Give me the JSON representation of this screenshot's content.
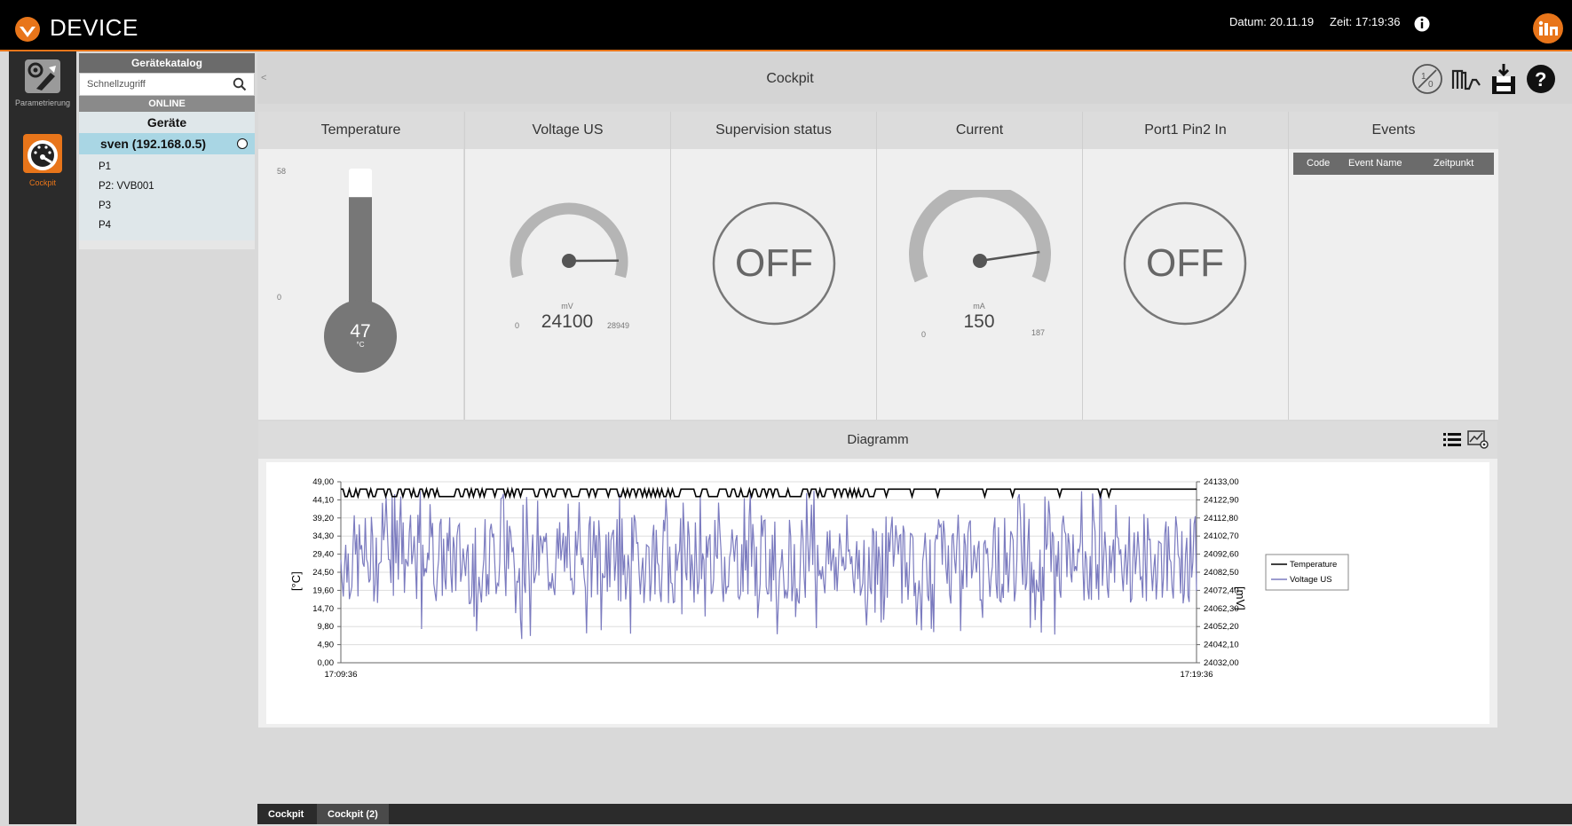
{
  "app": {
    "brand": "DEVICE",
    "date_text": "Datum: 20.11.19",
    "time_text": "Zeit: 17:19:36"
  },
  "nav": {
    "items": [
      {
        "label": "Parametrierung"
      },
      {
        "label": "Cockpit"
      }
    ]
  },
  "catalog": {
    "title": "Gerätekatalog",
    "search_placeholder": "Schnellzugriff",
    "status": "ONLINE",
    "group": "Geräte",
    "device": "sven (192.168.0.5)",
    "ports": [
      "P1",
      "P2: VVB001",
      "P3",
      "P4"
    ]
  },
  "header": {
    "title": "Cockpit"
  },
  "panels": {
    "temperature": {
      "title": "Temperature",
      "max": "58",
      "min": "0",
      "value": "47",
      "unit": "°C",
      "level": 47
    },
    "voltage": {
      "title": "Voltage US",
      "unit": "mV",
      "value": "24100",
      "min": "0",
      "max": "28949",
      "level": 24100,
      "max_num": 28949
    },
    "supervision": {
      "title": "Supervision status",
      "state": "OFF"
    },
    "current": {
      "title": "Current",
      "unit": "mA",
      "value": "150",
      "min": "0",
      "max": "187",
      "level": 150,
      "max_num": 187
    },
    "port1pin2": {
      "title": "Port1 Pin2 In",
      "state": "OFF"
    },
    "events": {
      "title": "Events",
      "columns": [
        "Code",
        "Event Name",
        "Zeitpunkt"
      ]
    }
  },
  "diagram": {
    "title": "Diagramm"
  },
  "chart_data": {
    "type": "line",
    "ylabel": "[°C]",
    "y2label": "[mV]",
    "y_ticks": [
      "49,00",
      "44,10",
      "39,20",
      "34,30",
      "29,40",
      "24,50",
      "19,60",
      "14,70",
      "9,80",
      "4,90",
      "0,00"
    ],
    "y2_ticks": [
      "24133,00",
      "24122,90",
      "24112,80",
      "24102,70",
      "24092,60",
      "24082,50",
      "24072,40",
      "24062,30",
      "24052,20",
      "24042,10",
      "24032,00"
    ],
    "x_ticks": [
      "17:09:36",
      "17:19:36"
    ],
    "ylim": [
      0,
      49
    ],
    "y2lim": [
      24032,
      24133
    ],
    "series": [
      {
        "name": "Temperature",
        "color": "#000000",
        "axis": "left",
        "approx_value": 47,
        "dip_value": 45
      },
      {
        "name": "Voltage US",
        "color": "#7b7bbf",
        "axis": "right",
        "approx_range": [
          24050,
          24125
        ]
      }
    ],
    "legend": "right",
    "grid": true
  },
  "tabs": [
    {
      "label": "Cockpit"
    },
    {
      "label": "Cockpit (2)"
    }
  ]
}
